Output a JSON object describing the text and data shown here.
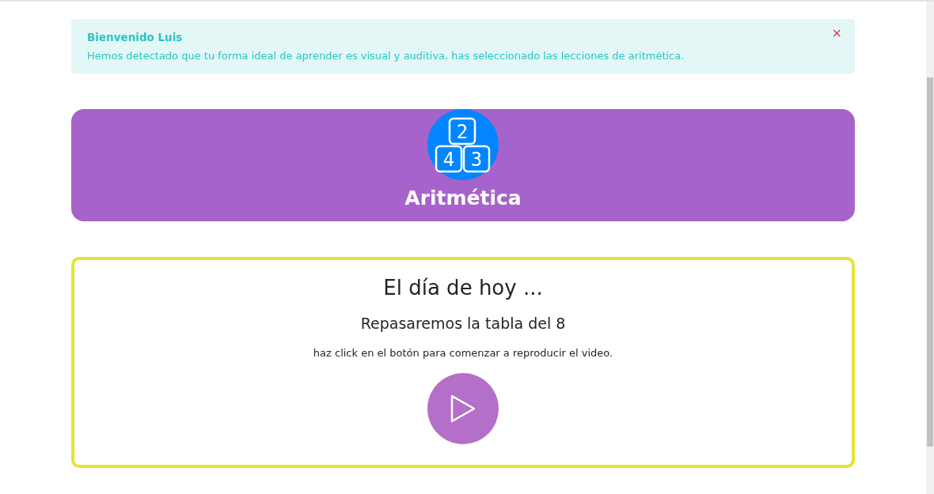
{
  "alert": {
    "title": "Bienvenido Luis",
    "message": "Hemos detectado que tu forma ideal de aprender es visual y auditiva, has seleccionado las lecciones de aritmética.",
    "close": "×"
  },
  "lesson": {
    "title": "Aritmética",
    "icon_blocks": [
      "2",
      "4",
      "3"
    ]
  },
  "today": {
    "heading": "El día de hoy ...",
    "subheading": "Repasaremos la tabla del 8",
    "instruction": "haz click en el botón para comenzar a reproducir el video."
  }
}
